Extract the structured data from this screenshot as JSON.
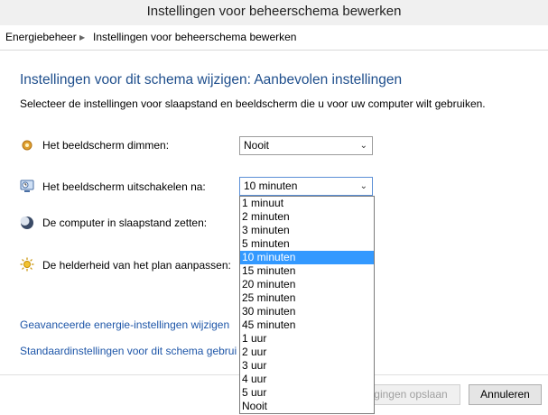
{
  "window": {
    "title": "Instellingen voor beheerschema bewerken"
  },
  "breadcrumb": {
    "root": "Energiebeheer",
    "current": "Instellingen voor beheerschema bewerken"
  },
  "main": {
    "heading": "Instellingen voor dit schema wijzigen: Aanbevolen instellingen",
    "subtitle": "Selecteer de instellingen voor slaapstand en beeldscherm die u voor uw computer wilt gebruiken."
  },
  "settings": {
    "dim": {
      "label": "Het beeldscherm dimmen:",
      "value": "Nooit",
      "icon": "brightness-dim-icon"
    },
    "off": {
      "label": "Het beeldscherm uitschakelen na:",
      "value": "10 minuten",
      "icon": "monitor-clock-icon"
    },
    "sleep": {
      "label": "De computer in slaapstand zetten:",
      "icon": "moon-icon"
    },
    "brightness": {
      "label": "De helderheid van het plan aanpassen:",
      "icon": "sun-icon"
    }
  },
  "dropdown": {
    "selected": "10 minuten",
    "options": [
      "1 minuut",
      "2 minuten",
      "3 minuten",
      "5 minuten",
      "10 minuten",
      "15 minuten",
      "20 minuten",
      "25 minuten",
      "30 minuten",
      "45 minuten",
      "1 uur",
      "2 uur",
      "3 uur",
      "4 uur",
      "5 uur",
      "Nooit"
    ]
  },
  "links": {
    "advanced": "Geavanceerde energie-instellingen wijzigen",
    "defaults": "Standaardinstellingen voor dit schema gebrui"
  },
  "footer": {
    "save": "gingen opslaan",
    "cancel": "Annuleren"
  },
  "colors": {
    "accent": "#1e4e8c",
    "link": "#1e56a8",
    "selection": "#3399ff"
  }
}
